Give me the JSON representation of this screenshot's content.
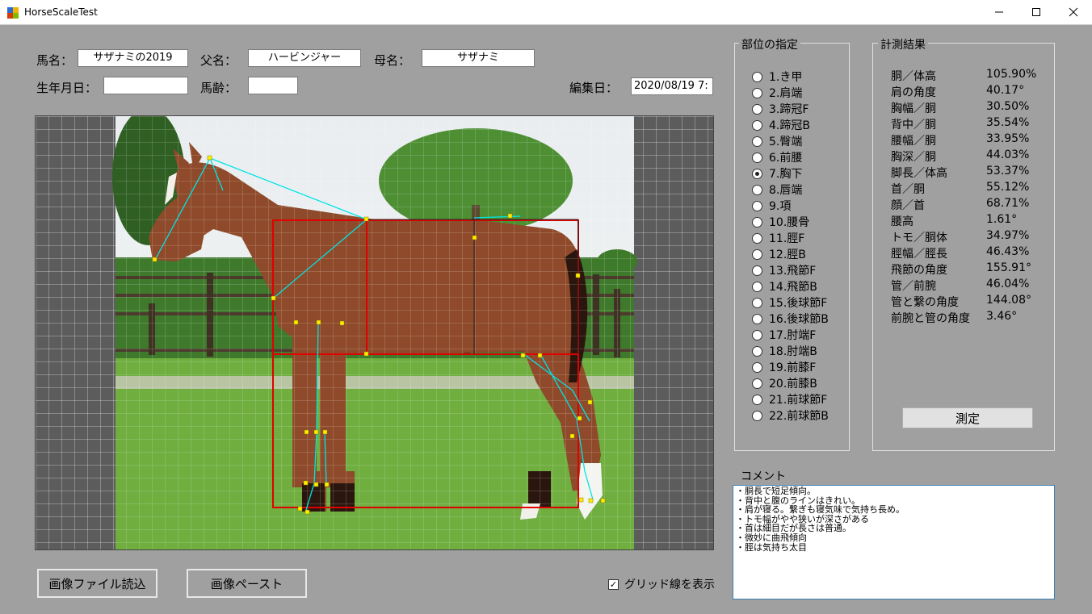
{
  "window": {
    "title": "HorseScaleTest"
  },
  "form": {
    "horse_name_label": "馬名：",
    "horse_name_value": "サザナミの2019",
    "sire_label": "父名：",
    "sire_value": "ハービンジャー",
    "dam_label": "母名：",
    "dam_value": "サザナミ",
    "birthdate_label": "生年月日：",
    "birthdate_value": "",
    "age_label": "馬齢：",
    "age_value": "",
    "edit_date_label": "編集日：",
    "edit_date_value": "2020/08/19 7:"
  },
  "parts": {
    "title": "部位の指定",
    "selected_index": 6,
    "items": [
      "1.き甲",
      "2.肩端",
      "3.蹄冠F",
      "4.蹄冠B",
      "5.臀端",
      "6.前腰",
      "7.胸下",
      "8.唇端",
      "9.項",
      "10.腰骨",
      "11.脛F",
      "12.脛B",
      "13.飛節F",
      "14.飛節B",
      "15.後球節F",
      "16.後球節B",
      "17.肘端F",
      "18.肘端B",
      "19.前膝F",
      "20.前膝B",
      "21.前球節F",
      "22.前球節B"
    ]
  },
  "results": {
    "title": "計測結果",
    "items": [
      {
        "name": "胴／体高",
        "value": "105.90%"
      },
      {
        "name": "肩の角度",
        "value": "40.17°"
      },
      {
        "name": "胸幅／胴",
        "value": "30.50%"
      },
      {
        "name": "背中／胴",
        "value": "35.54%"
      },
      {
        "name": "腰幅／胴",
        "value": "33.95%"
      },
      {
        "name": "胸深／胴",
        "value": "44.03%"
      },
      {
        "name": "脚長／体高",
        "value": "53.37%"
      },
      {
        "name": "首／胴",
        "value": "55.12%"
      },
      {
        "name": "顔／首",
        "value": "68.71%"
      },
      {
        "name": "腰高",
        "value": "1.61°"
      },
      {
        "name": "トモ／胴体",
        "value": "34.97%"
      },
      {
        "name": "脛幅／脛長",
        "value": "46.43%"
      },
      {
        "name": "飛節の角度",
        "value": "155.91°"
      },
      {
        "name": "管／前腕",
        "value": "46.04%"
      },
      {
        "name": "管と繋の角度",
        "value": "144.08°"
      },
      {
        "name": "前腕と管の角度",
        "value": "3.46°"
      }
    ],
    "measure_button": "測定"
  },
  "comment": {
    "label": "コメント",
    "lines": [
      "・胴長で短足傾向。",
      "・背中と腹のラインはきれい。",
      "・肩が寝る。繋ぎも寝気味で気持ち長め。",
      "・トモ幅がやや狭いが深さがある",
      "・首は細目だが長さは普通。",
      "・微妙に曲飛傾向",
      "・脛は気持ち太目"
    ]
  },
  "buttons": {
    "load_image": "画像ファイル読込",
    "paste_image": "画像ペースト"
  },
  "grid_toggle": {
    "label": "グリッド線を表示",
    "checked": true
  },
  "colors": {
    "window_bg": "#a0a0a0",
    "measure_box": "#e00000",
    "measure_line": "#00e5e5",
    "marker": "#ffee00"
  }
}
